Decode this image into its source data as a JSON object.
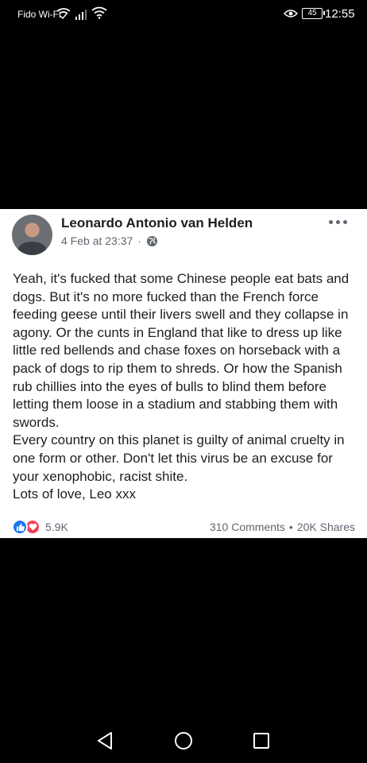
{
  "status_bar": {
    "carrier": "Fido Wi-Fi",
    "battery": "45",
    "time": "12:55",
    "icons": [
      "wifi-calling-icon",
      "signal-icon",
      "wifi-icon",
      "eye-comfort-icon",
      "battery-icon"
    ]
  },
  "post": {
    "author": "Leonardo Antonio van Helden",
    "date": "4 Feb at 23:37",
    "separator": "·",
    "privacy_icon": "globe-icon",
    "paragraphs": [
      "Yeah, it's fucked that some Chinese people eat bats and dogs. But it's no more fucked than the French force feeding geese until their livers swell and they collapse in agony. Or the cunts in England that like to dress up like little red bellends and chase foxes on horseback with a pack of dogs to rip them to shreds. Or how the Spanish rub chillies into the eyes of bulls to blind them before letting them loose in a stadium and stabbing them with swords.",
      "Every country on this planet is guilty of animal cruelty in one form or other. Don't let this virus be an excuse for your xenophobic, racist shite.",
      "Lots of love, Leo xxx"
    ],
    "reactions_count": "5.9K",
    "comments": "310 Comments",
    "stats_separator": "•",
    "shares": "20K Shares",
    "colors": {
      "like": "#1877f2",
      "love": "#f33e58"
    }
  },
  "nav": {
    "icons": [
      "back-icon",
      "home-icon",
      "recents-icon"
    ]
  }
}
